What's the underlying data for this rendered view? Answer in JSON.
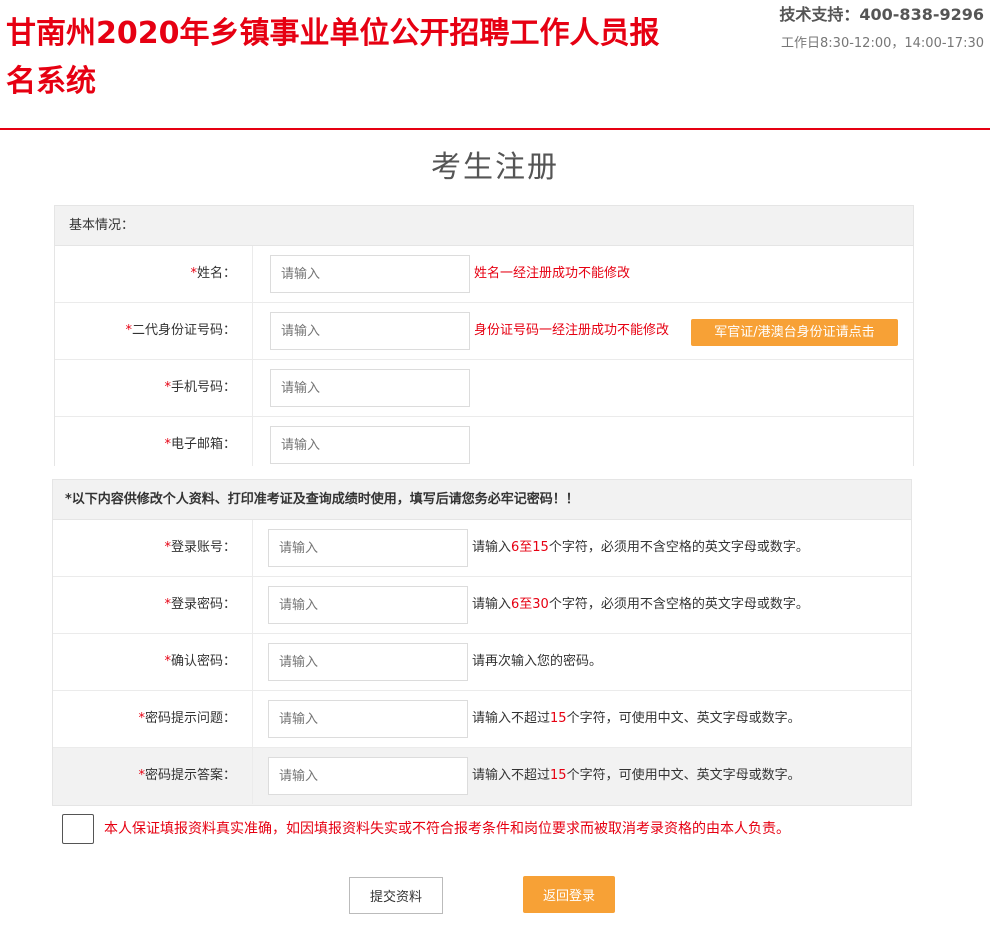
{
  "header": {
    "title": "甘南州2020年乡镇事业单位公开招聘工作人员报名系统",
    "support_label": "技术支持：",
    "support_phone": "400-838-9296",
    "support_hours": "工作日8:30-12:00，14:00-17:30"
  },
  "page_title": "考生注册",
  "basic": {
    "heading": "基本情况：",
    "required_mark": "*",
    "name_label": "姓名：",
    "name_placeholder": "请输入",
    "name_hint": "姓名一经注册成功不能修改",
    "id_label": "二代身份证号码：",
    "id_placeholder": "请输入",
    "id_hint": "身份证号码一经注册成功不能修改",
    "id_alt_button": "军官证/港澳台身份证请点击",
    "phone_label": "手机号码：",
    "phone_placeholder": "请输入",
    "email_label": "电子邮箱：",
    "email_placeholder": "请输入"
  },
  "account": {
    "heading": "*以下内容供修改个人资料、打印准考证及查询成绩时使用，填写后请您务必牢记密码！！",
    "required_mark": "*",
    "login_label": "登录账号：",
    "login_placeholder": "请输入",
    "login_hint_pre": "请输入",
    "login_hint_num": "6至15",
    "login_hint_post": "个字符，必须用不含空格的英文字母或数字。",
    "password_label": "登录密码：",
    "password_placeholder": "请输入",
    "password_hint_pre": "请输入",
    "password_hint_num": "6至30",
    "password_hint_post": "个字符，必须用不含空格的英文字母或数字。",
    "confirm_label": "确认密码：",
    "confirm_placeholder": "请输入",
    "confirm_hint": "请再次输入您的密码。",
    "question_label": "密码提示问题：",
    "question_placeholder": "请输入",
    "question_hint_pre": "请输入不超过",
    "question_hint_num": "15",
    "question_hint_post": "个字符，可使用中文、英文字母或数字。",
    "answer_label": "密码提示答案：",
    "answer_placeholder": "请输入",
    "answer_hint_pre": "请输入不超过",
    "answer_hint_num": "15",
    "answer_hint_post": "个字符，可使用中文、英文字母或数字。"
  },
  "agreement": {
    "text": "本人保证填报资料真实准确，如因填报资料失实或不符合报考条件和岗位要求而被取消考录资格的由本人负责。"
  },
  "buttons": {
    "submit": "提交资料",
    "back": "返回登录"
  }
}
